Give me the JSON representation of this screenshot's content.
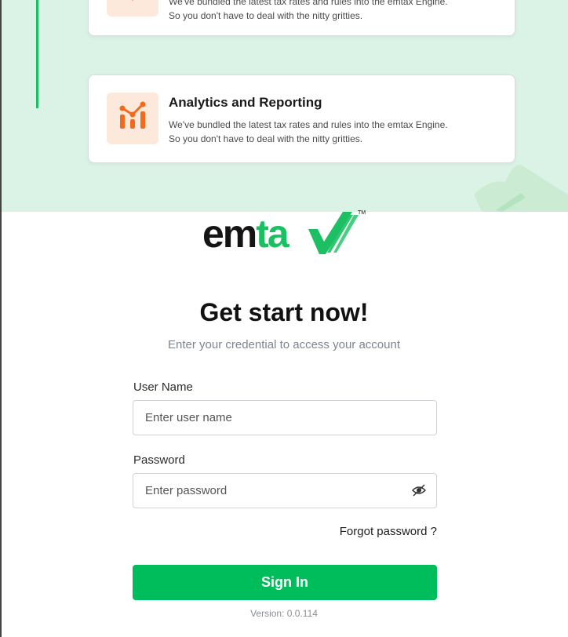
{
  "promo": {
    "cards": [
      {
        "title": "",
        "desc_line1": "We've bundled the latest tax rates and rules into the emtax Engine.",
        "desc_line2": "So you don't have to deal with the nitty gritties.",
        "icon": "document-icon"
      },
      {
        "title": "Analytics and Reporting",
        "desc_line1": "We've bundled the latest tax rates and rules into the emtax Engine.",
        "desc_line2": "So you don't have to deal with the nitty gritties.",
        "icon": "analytics-icon"
      }
    ]
  },
  "logo": {
    "em": "em",
    "ta": "ta",
    "tm": "TM"
  },
  "login": {
    "title": "Get start now!",
    "subtitle": "Enter your credential to access your account",
    "username_label": "User Name",
    "username_placeholder": "Enter user name",
    "password_label": "Password",
    "password_placeholder": "Enter password",
    "forgot": "Forgot password ?",
    "signin": "Sign In",
    "version": "Version: 0.0.114"
  },
  "colors": {
    "brand_green": "#00bd5b",
    "panel_bg": "#dbf3e6",
    "icon_orange": "#f26b1d",
    "icon_bg": "#fde8dc"
  }
}
